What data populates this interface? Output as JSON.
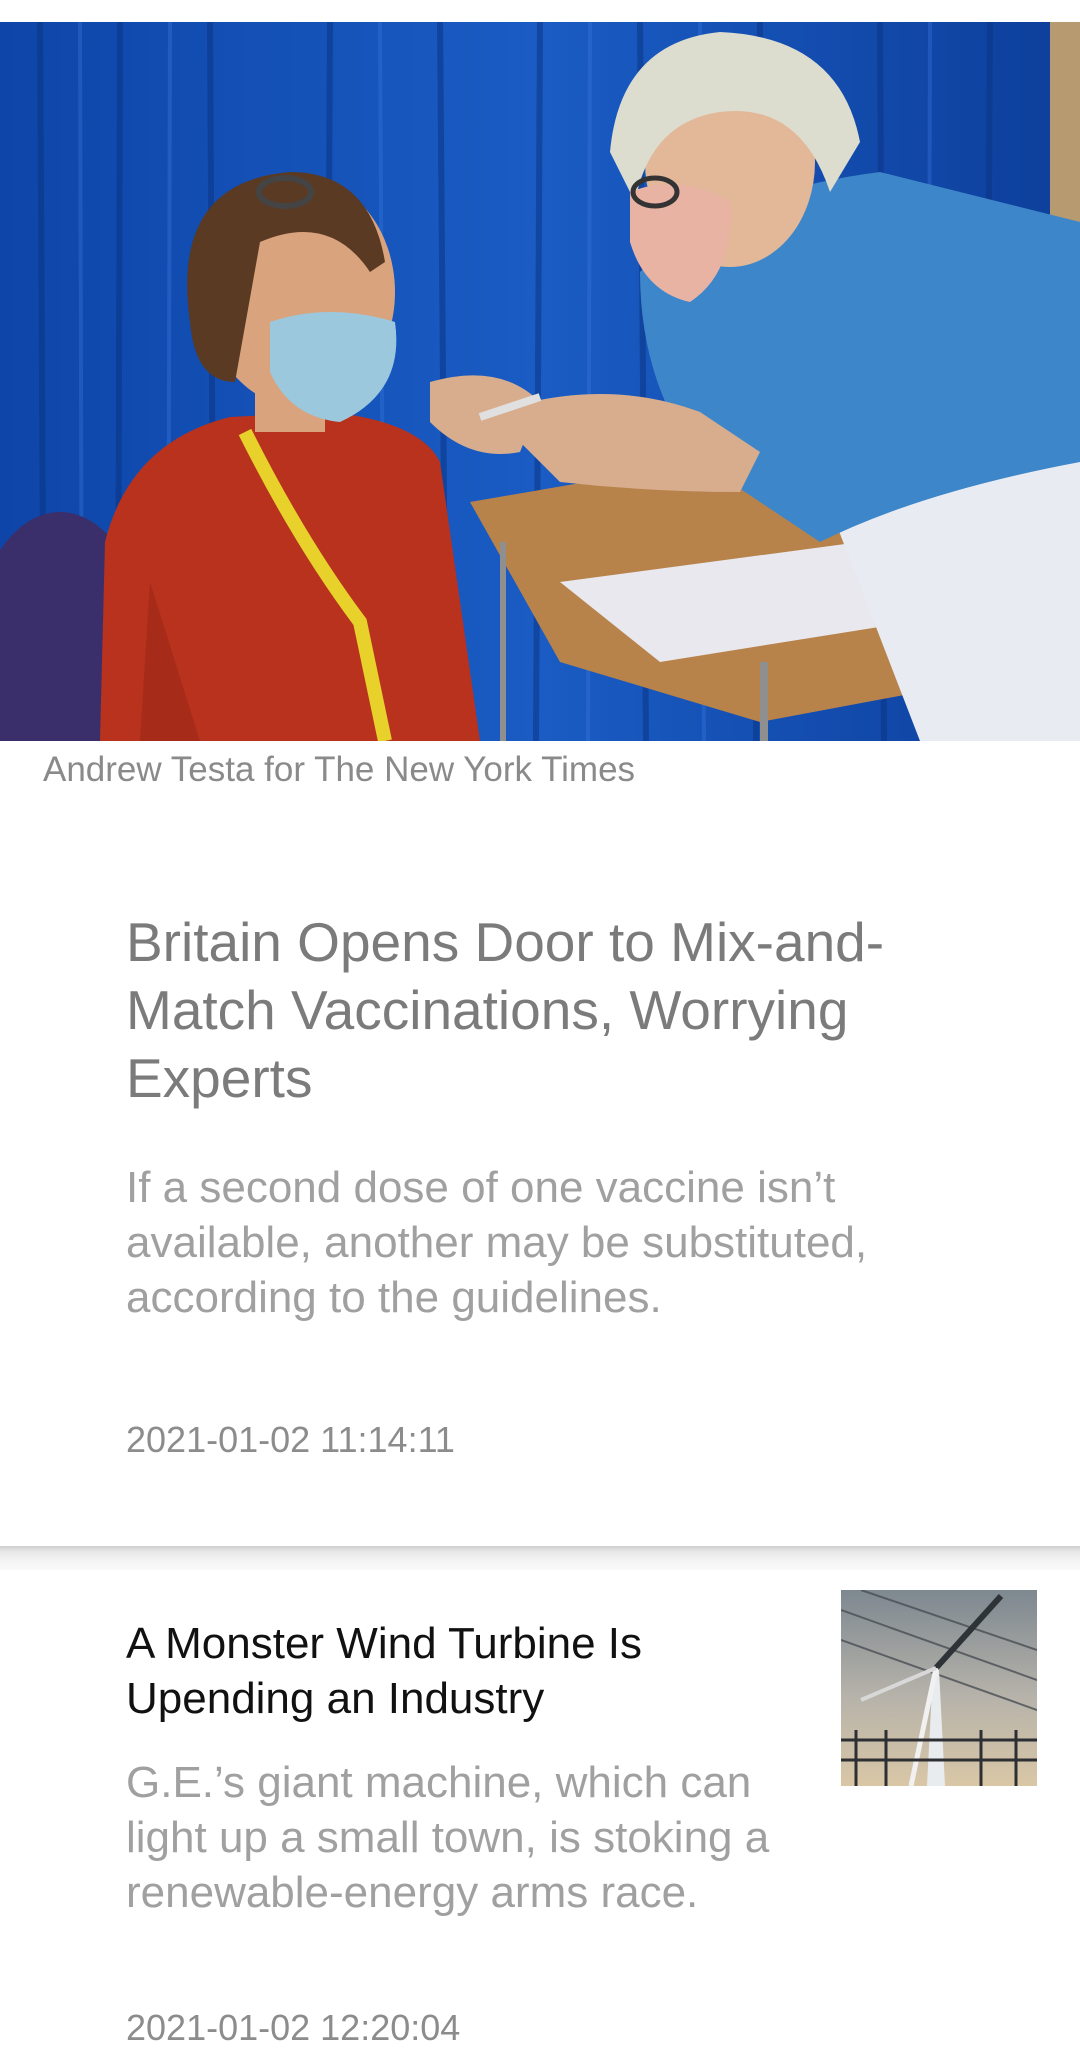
{
  "feed": {
    "lead_article": {
      "photo_credit": "Andrew Testa for The New York Times",
      "title": "Britain Opens Door to Mix-and-Match Vaccinations, Worrying Experts",
      "summary": "If a second dose of one vaccine isn’t available, another may be substituted, according to the guidelines.",
      "timestamp": "2021-01-02 11:14:11"
    },
    "second_article": {
      "title": "A Monster Wind Turbine Is Upending an Industry",
      "summary": "G.E.’s giant machine, which can light up a small town, is stoking a renewable-energy arms race.",
      "timestamp": "2021-01-02 12:20:04"
    }
  },
  "colors": {
    "curtain_blue": "#1452b8",
    "scrubs_blue": "#3d86c9",
    "sweater_red": "#b8321e",
    "lanyard_yellow": "#e7d12a",
    "title_gray": "#7b7b7b",
    "summary_gray": "#a0a0a0"
  },
  "icons": {
    "hero_image": "vaccination-photo",
    "thumbnail_image": "wind-turbine-photo"
  }
}
